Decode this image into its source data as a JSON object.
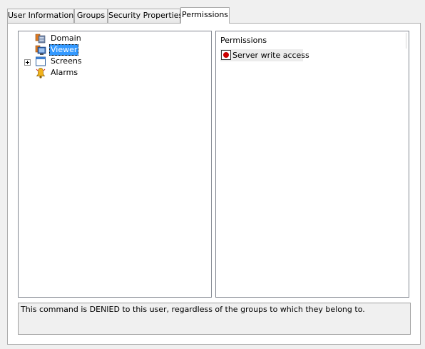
{
  "tabs": [
    {
      "label": "User Information"
    },
    {
      "label": "Groups"
    },
    {
      "label": "Security Properties"
    },
    {
      "label": "Permissions",
      "active": true
    }
  ],
  "tree": {
    "items": [
      {
        "label": "Domain",
        "icon": "domain-icon"
      },
      {
        "label": "Viewer",
        "icon": "viewer-icon",
        "selected": true
      },
      {
        "label": "Screens",
        "icon": "screens-icon",
        "expandable": true
      },
      {
        "label": "Alarms",
        "icon": "alarms-icon"
      }
    ]
  },
  "permissions": {
    "header": "Permissions",
    "items": [
      {
        "label": "Server write access",
        "state": "denied",
        "icon": "denied-record-icon"
      }
    ]
  },
  "message": "This command is DENIED to this user, regardless of the groups to which they belong to.",
  "colors": {
    "selection": "#3399ff",
    "denied": "#cc0000",
    "window_bg": "#f0f0f0"
  }
}
